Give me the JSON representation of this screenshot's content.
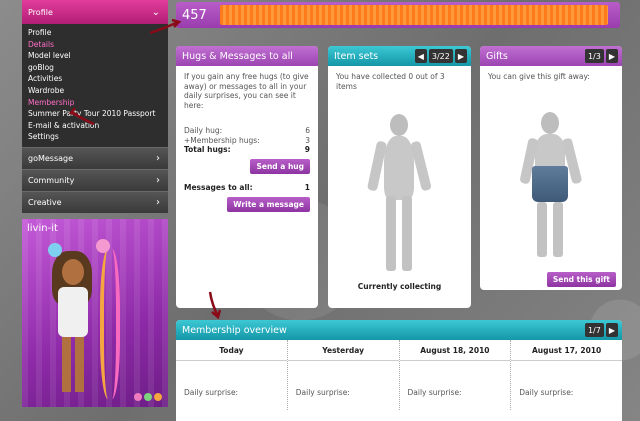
{
  "sidebar": {
    "profile_header": "Profile",
    "profile_items": [
      {
        "label": "Profile",
        "active": false
      },
      {
        "label": "Details",
        "active": true
      },
      {
        "label": "Model level",
        "active": false
      },
      {
        "label": "goBlog",
        "active": false
      },
      {
        "label": "Activities",
        "active": false
      },
      {
        "label": "Wardrobe",
        "active": false
      },
      {
        "label": "Membership",
        "active": true
      },
      {
        "label": "Summer Party Tour 2010 Passport",
        "active": false
      },
      {
        "label": "E-mail & activation",
        "active": false
      },
      {
        "label": "Settings",
        "active": false
      }
    ],
    "other_menus": [
      "goMessage",
      "Community",
      "Creative"
    ],
    "avatar_name": "livin-it"
  },
  "stats": {
    "value": "457",
    "progress_fraction": 0.98
  },
  "hugs_panel": {
    "title": "Hugs & Messages to all",
    "description": "If you gain any free hugs (to give away) or messages to all in your daily surprises, you can see it here:",
    "daily_hug_label": "Daily hug:",
    "daily_hug_value": "6",
    "membership_hugs_label": "+Membership hugs:",
    "membership_hugs_value": "3",
    "total_hugs_label": "Total hugs:",
    "total_hugs_value": "9",
    "send_hug_label": "Send a hug",
    "messages_label": "Messages to all:",
    "messages_value": "1",
    "write_message_label": "Write a message"
  },
  "item_sets_panel": {
    "title": "Item sets",
    "page": "3/22",
    "collected_text": "You have collected 0 out of 3 items",
    "status": "Currently collecting"
  },
  "gifts_panel": {
    "title": "Gifts",
    "page": "1/3",
    "subtitle": "You can give this gift away:",
    "send_label": "Send this gift"
  },
  "overview_panel": {
    "title": "Membership overview",
    "page": "1/7",
    "columns": [
      "Today",
      "Yesterday",
      "August 18, 2010",
      "August 17, 2010"
    ],
    "row_label": "Daily surprise:"
  },
  "icons": {
    "prev": "◀",
    "next": "▶",
    "chevron": "›"
  },
  "colors": {
    "profile_pink": "#d12e8c",
    "panel_purple": "#a84fbd",
    "panel_teal": "#1fa7b6",
    "progress_orange": "#ff8a2a"
  }
}
